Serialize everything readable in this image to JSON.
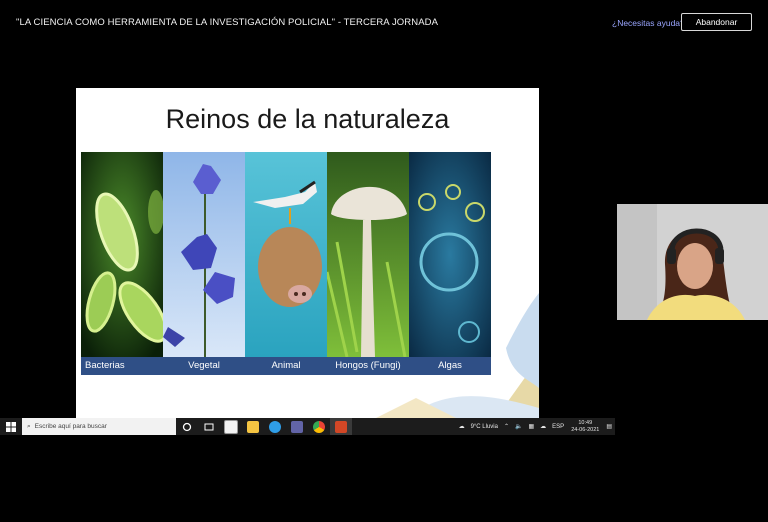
{
  "header": {
    "session_title": "\"LA CIENCIA COMO HERRAMIENTA DE LA INVESTIGACIÓN POLICIAL\" - TERCERA JORNADA",
    "help_link": "¿Necesitas ayuda?",
    "leave_button": "Abandonar"
  },
  "slide": {
    "title": "Reinos de la naturaleza",
    "panels": [
      {
        "label": "Bacterias",
        "icon": "bacteria-image"
      },
      {
        "label": "Vegetal",
        "icon": "flower-image"
      },
      {
        "label": "Animal",
        "icon": "pig-bird-image"
      },
      {
        "label": "Hongos (Fungi)",
        "icon": "mushroom-image"
      },
      {
        "label": "Algas",
        "icon": "algae-image"
      }
    ]
  },
  "taskbar": {
    "search_placeholder": "Escribe aquí para buscar",
    "weather": "9°C  Lluvia",
    "language": "ESP",
    "time": "10:49",
    "date": "24-06-2021",
    "apps": [
      "task-view",
      "store",
      "file-explorer",
      "edge",
      "teams",
      "chrome",
      "powerpoint"
    ]
  },
  "colors": {
    "background": "#000000",
    "label_bar": "#2f4f86",
    "help_link": "#9aa6ff"
  }
}
